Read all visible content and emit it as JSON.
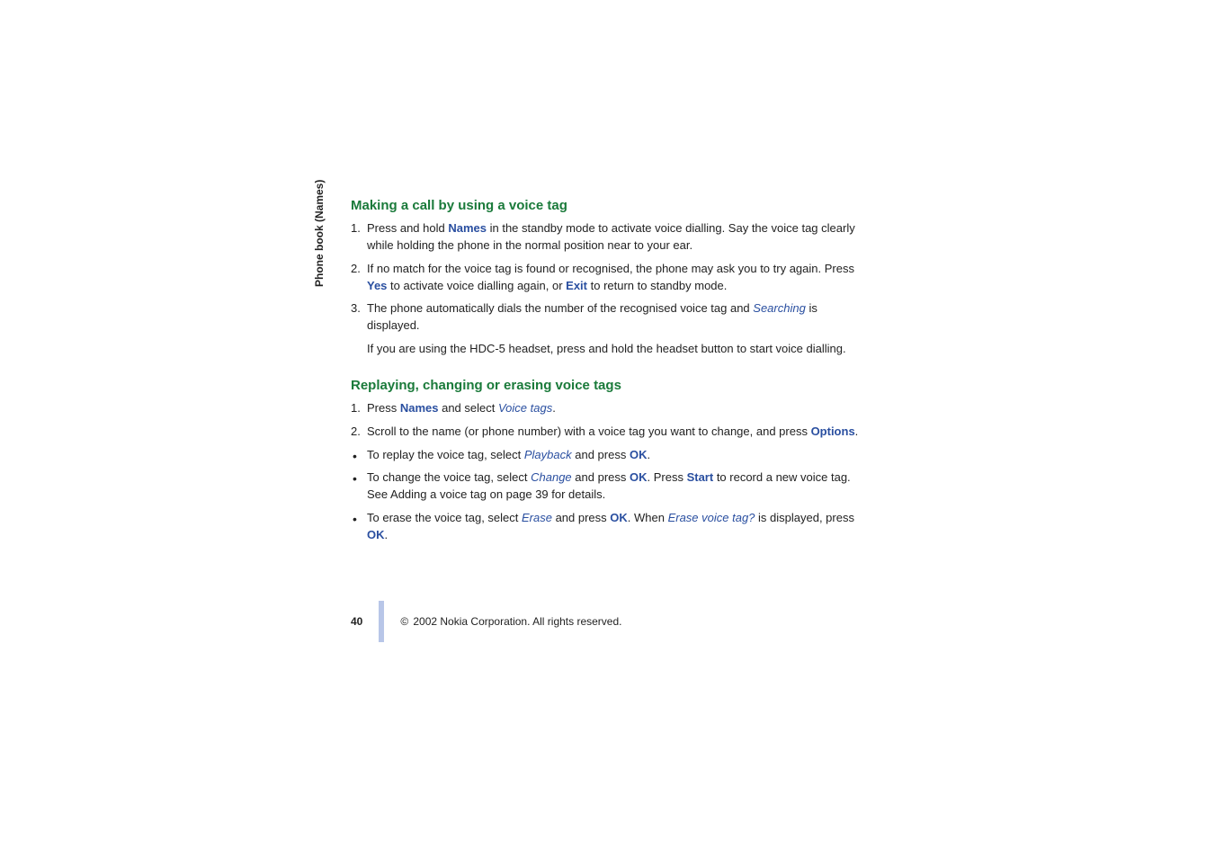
{
  "side_label": "Phone book (Names)",
  "section1": {
    "heading": "Making a call by using a voice tag",
    "items": [
      {
        "pre": "Press and hold ",
        "kw1": "Names",
        "post": " in the standby mode to activate voice dialling. Say the voice tag clearly while holding the phone in the normal position near to your ear."
      },
      {
        "pre": "If no match for the voice tag is found or recognised, the phone may ask you to try again. Press ",
        "kw1": "Yes",
        "mid": " to activate voice dialling again, or ",
        "kw2": "Exit",
        "post": " to return to standby mode."
      },
      {
        "pre": "The phone automatically dials the number of the recognised voice tag and ",
        "it1": "Searching",
        "post": " is displayed."
      }
    ],
    "extra": "If you are using the HDC-5 headset, press and hold the headset button to start voice dialling."
  },
  "section2": {
    "heading": "Replaying, changing or erasing voice tags",
    "ol": [
      {
        "pre": "Press ",
        "kw1": "Names",
        "mid": " and select ",
        "it1": "Voice tags",
        "post": "."
      },
      {
        "pre": "Scroll to the name (or phone number) with a voice tag you want to change, and press ",
        "kw1": "Options",
        "post": "."
      }
    ],
    "ul": [
      {
        "pre": "To replay the voice tag, select ",
        "it1": "Playback",
        "mid": " and press ",
        "kw1": "OK",
        "post": "."
      },
      {
        "pre": "To change the voice tag, select ",
        "it1": "Change",
        "mid": " and press ",
        "kw1": "OK",
        "mid2": ". Press ",
        "kw2": "Start",
        "post": " to record a new voice tag. See Adding a voice tag on page 39 for details."
      },
      {
        "pre": "To erase the voice tag, select ",
        "it1": "Erase",
        "mid": " and press ",
        "kw1": "OK",
        "mid2": ". When ",
        "it2": "Erase voice tag?",
        "mid3": " is displayed, press ",
        "kw2": "OK",
        "post": "."
      }
    ]
  },
  "footer": {
    "page": "40",
    "copyright": " 2002 Nokia Corporation. All rights reserved."
  }
}
